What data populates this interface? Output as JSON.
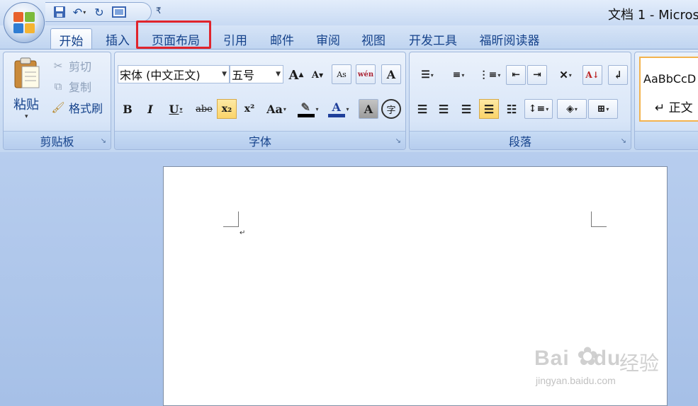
{
  "window": {
    "title": "文档 1 - Micros"
  },
  "quick_access": {
    "icons": [
      "save-icon",
      "undo-icon",
      "redo-icon",
      "print-preview-icon"
    ],
    "customize_glyph": "₹"
  },
  "tabs": [
    {
      "label": "开始",
      "active": true
    },
    {
      "label": "插入"
    },
    {
      "label": "页面布局",
      "highlighted": true
    },
    {
      "label": "引用"
    },
    {
      "label": "邮件"
    },
    {
      "label": "审阅"
    },
    {
      "label": "视图"
    },
    {
      "label": "开发工具"
    },
    {
      "label": "福昕阅读器"
    }
  ],
  "clipboard": {
    "group_label": "剪贴板",
    "paste_label": "粘贴",
    "cut_label": "剪切",
    "copy_label": "复制",
    "format_painter_label": "格式刷"
  },
  "font": {
    "group_label": "字体",
    "font_name": "宋体 (中文正文)",
    "font_size": "五号",
    "bold": "B",
    "italic": "I",
    "underline": "U",
    "strike": "abe",
    "subscript": "x₂",
    "superscript": "x²",
    "change_case": "Aa",
    "grow": "A",
    "shrink": "A",
    "phonetic": "wén",
    "char_border": "A",
    "char_shading": "A",
    "enclose": "字",
    "font_color": "A",
    "highlight_color": "#000000",
    "font_color_hex": "#1f3f9a"
  },
  "paragraph": {
    "group_label": "段落"
  },
  "styles": {
    "sample": "AaBbCcD",
    "name": "↵ 正文"
  },
  "document": {
    "paragraph_mark": "↵"
  },
  "watermark": {
    "brand": "Bai",
    "brand2": "du",
    "cn": "经验",
    "url": "jingyan.baidu.com"
  }
}
